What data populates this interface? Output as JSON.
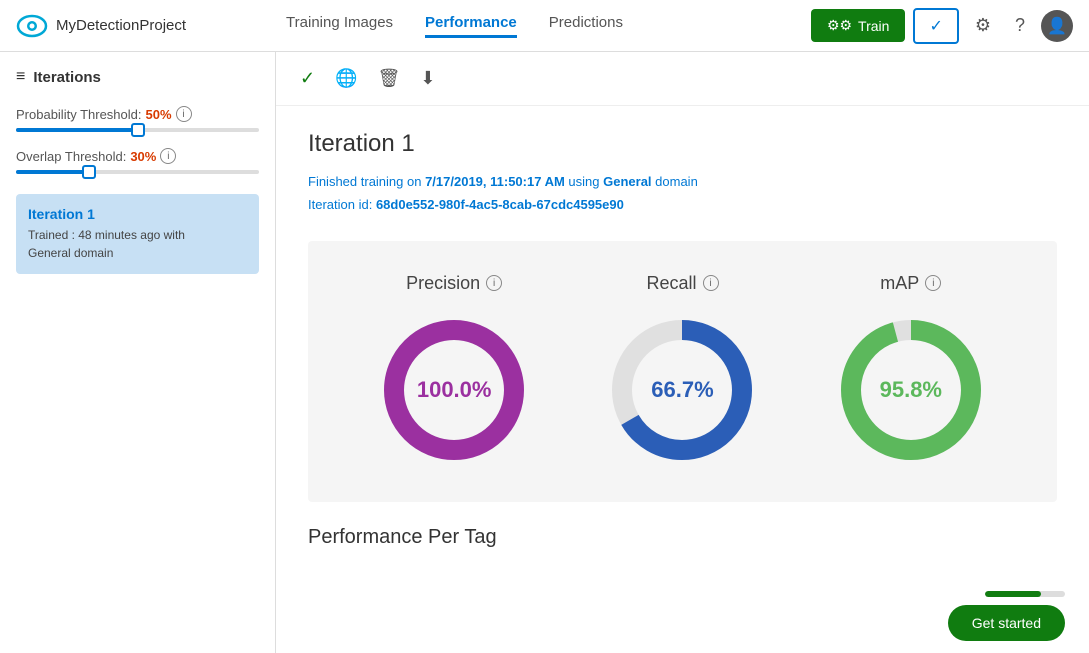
{
  "header": {
    "project_name": "MyDetectionProject",
    "tabs": [
      {
        "id": "training",
        "label": "Training Images",
        "active": false
      },
      {
        "id": "performance",
        "label": "Performance",
        "active": true
      },
      {
        "id": "predictions",
        "label": "Predictions",
        "active": false
      }
    ],
    "train_button_label": "Train",
    "check_icon": "✓",
    "settings_icon": "⚙",
    "help_icon": "?",
    "avatar_icon": "👤"
  },
  "sidebar": {
    "title": "Iterations",
    "probability_threshold_label": "Probability Threshold:",
    "probability_threshold_value": "50%",
    "overlap_threshold_label": "Overlap Threshold:",
    "overlap_threshold_value": "30%",
    "iteration": {
      "name": "Iteration 1",
      "desc_line1": "Trained : 48 minutes ago with",
      "desc_line2": "General domain"
    }
  },
  "content": {
    "toolbar": {
      "check_icon": "✓",
      "globe_icon": "🌐",
      "trash_icon": "🗑",
      "download_icon": "⬇"
    },
    "iteration_title": "Iteration 1",
    "training_info_line1_pre": "Finished training on ",
    "training_info_date": "7/17/2019, 11:50:17 AM",
    "training_info_mid": " using ",
    "training_info_domain": "General",
    "training_info_post": " domain",
    "iteration_id_label": "Iteration id: ",
    "iteration_id_value": "68d0e552-980f-4ac5-8cab-67cdc4595e90",
    "metrics": [
      {
        "id": "precision",
        "label": "Precision",
        "value": "100.0%",
        "color": "#9b30a0",
        "percentage": 100
      },
      {
        "id": "recall",
        "label": "Recall",
        "value": "66.7%",
        "color": "#2b5eb7",
        "percentage": 66.7
      },
      {
        "id": "map",
        "label": "mAP",
        "value": "95.8%",
        "color": "#5cb85c",
        "percentage": 95.8
      }
    ],
    "performance_per_tag_label": "Performance Per Tag",
    "get_started_label": "Get started"
  }
}
